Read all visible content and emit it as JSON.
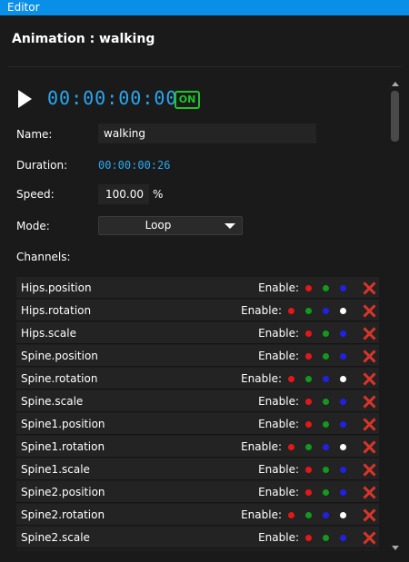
{
  "window": {
    "title": "Editor"
  },
  "header": {
    "title": "Animation : walking"
  },
  "playback": {
    "timecode": "00:00:00:00",
    "on_label": "ON"
  },
  "fields": {
    "name_label": "Name:",
    "name_value": "walking",
    "duration_label": "Duration:",
    "duration_value": "00:00:00:26",
    "speed_label": "Speed:",
    "speed_value": "100.00",
    "speed_unit": "%",
    "mode_label": "Mode:",
    "mode_value": "Loop",
    "channels_label": "Channels:"
  },
  "channel_enable_label": "Enable:",
  "channels": [
    {
      "name": "Hips.position",
      "dots": [
        "#e41818",
        "#119a1c",
        "#2020e8"
      ]
    },
    {
      "name": "Hips.rotation",
      "dots": [
        "#e41818",
        "#119a1c",
        "#2020e8",
        "#ffffff"
      ]
    },
    {
      "name": "Hips.scale",
      "dots": [
        "#e41818",
        "#119a1c",
        "#2020e8"
      ]
    },
    {
      "name": "Spine.position",
      "dots": [
        "#e41818",
        "#119a1c",
        "#2020e8"
      ]
    },
    {
      "name": "Spine.rotation",
      "dots": [
        "#e41818",
        "#119a1c",
        "#2020e8",
        "#ffffff"
      ]
    },
    {
      "name": "Spine.scale",
      "dots": [
        "#e41818",
        "#119a1c",
        "#2020e8"
      ]
    },
    {
      "name": "Spine1.position",
      "dots": [
        "#e41818",
        "#119a1c",
        "#2020e8"
      ]
    },
    {
      "name": "Spine1.rotation",
      "dots": [
        "#e41818",
        "#119a1c",
        "#2020e8",
        "#ffffff"
      ]
    },
    {
      "name": "Spine1.scale",
      "dots": [
        "#e41818",
        "#119a1c",
        "#2020e8"
      ]
    },
    {
      "name": "Spine2.position",
      "dots": [
        "#e41818",
        "#119a1c",
        "#2020e8"
      ]
    },
    {
      "name": "Spine2.rotation",
      "dots": [
        "#e41818",
        "#119a1c",
        "#2020e8",
        "#ffffff"
      ]
    },
    {
      "name": "Spine2.scale",
      "dots": [
        "#e41818",
        "#119a1c",
        "#2020e8"
      ]
    }
  ],
  "colors": {
    "accent": "#0a8fe8",
    "timecode": "#2aa8f2",
    "on": "#22c22a",
    "delete": "#d8352a"
  }
}
